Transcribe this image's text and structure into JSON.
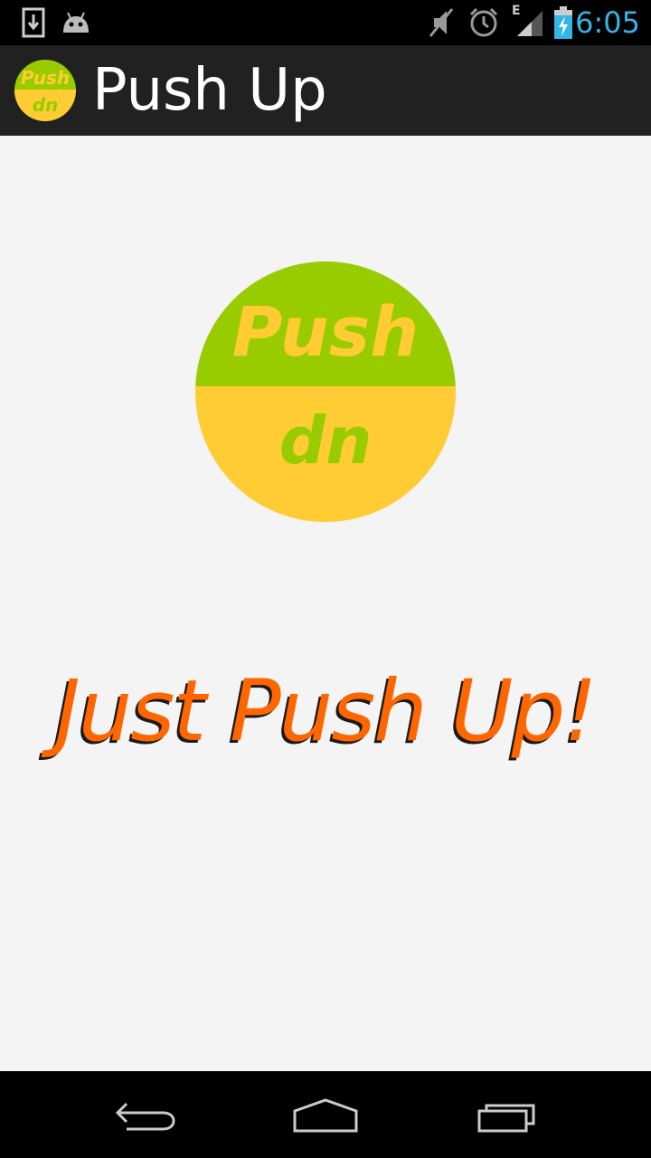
{
  "status_bar": {
    "time": "6:05",
    "network_type": "E",
    "icons": [
      "download-icon",
      "android-icon",
      "mute-icon",
      "alarm-icon",
      "signal-icon",
      "battery-charging-icon"
    ]
  },
  "action_bar": {
    "title": "Push Up",
    "logo_top_text": "Push",
    "logo_bottom_text": "dn"
  },
  "main": {
    "logo_top_text": "Push",
    "logo_bottom_text": "dn",
    "tagline": "Just Push Up!"
  },
  "nav_bar": {
    "buttons": [
      "back-icon",
      "home-icon",
      "recent-apps-icon"
    ]
  },
  "colors": {
    "accent_time": "#33b5e5",
    "logo_green": "#99cc00",
    "logo_yellow": "#ffcc33",
    "tagline_orange": "#ff6600"
  }
}
